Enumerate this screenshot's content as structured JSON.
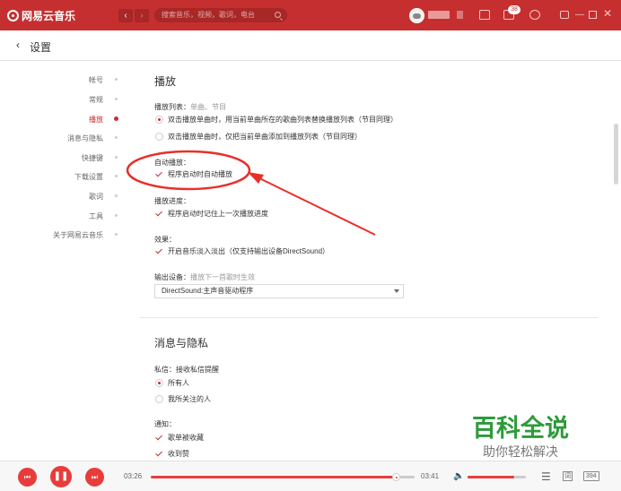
{
  "app": {
    "name": "网易云音乐",
    "search_placeholder": "搜索音乐，视频，歌词，电台",
    "notification_count": "38"
  },
  "page": {
    "title": "设置",
    "back_glyph": "‹"
  },
  "nav": {
    "items": [
      {
        "label": "帐号",
        "active": false
      },
      {
        "label": "常规",
        "active": false
      },
      {
        "label": "播放",
        "active": true
      },
      {
        "label": "消息与隐私",
        "active": false
      },
      {
        "label": "快捷键",
        "active": false
      },
      {
        "label": "下载设置",
        "active": false
      },
      {
        "label": "歌词",
        "active": false
      },
      {
        "label": "工具",
        "active": false
      },
      {
        "label": "关于网易云音乐",
        "active": false
      }
    ]
  },
  "play": {
    "title": "播放",
    "playlist_label": "播放列表：",
    "playlist_sub": "单曲、节目",
    "playlist_options": [
      {
        "label": "双击播放单曲时，用当前单曲所在的歌曲列表替换播放列表（节目同理）",
        "checked": true
      },
      {
        "label": "双击播放单曲时，仅把当前单曲添加到播放列表（节目同理）",
        "checked": false
      }
    ],
    "autoplay_label": "自动播放：",
    "autoplay_option": "程序启动时自动播放",
    "progress_label": "播放进度：",
    "progress_option": "程序启动时记住上一次播放进度",
    "effect_label": "效果：",
    "effect_option": "开启音乐淡入淡出（仅支持输出设备DirectSound）",
    "output_label": "输出设备：",
    "output_sub": "播放下一首歌时生效",
    "output_value": "DirectSound:主声音驱动程序"
  },
  "privacy": {
    "title": "消息与隐私",
    "dm_label": "私信：",
    "dm_sub": "接收私信提醒",
    "dm_options": [
      {
        "label": "所有人",
        "checked": true
      },
      {
        "label": "我所关注的人",
        "checked": false
      }
    ],
    "notify_label": "通知：",
    "notify_options": [
      {
        "label": "歌单被收藏",
        "checked": true
      },
      {
        "label": "收到赞",
        "checked": true
      }
    ]
  },
  "player": {
    "current_time": "03:26",
    "duration": "03:41",
    "progress_fraction": 0.93,
    "volume_fraction": 0.8,
    "lyric_label": "词",
    "playlist_count": "394"
  },
  "watermark": {
    "line1": "百科全说",
    "line2": "助你轻松解决"
  },
  "colors": {
    "accent": "#c62f2f",
    "annotation": "#e8302a",
    "watermark": "#2b9b3a"
  },
  "icons": [
    "logo-icon",
    "back-arrow-icon",
    "forward-arrow-icon",
    "search-icon",
    "avatar-icon",
    "skin-icon",
    "mail-icon",
    "gear-icon",
    "mini-mode-icon",
    "minimize-icon",
    "maximize-icon",
    "close-icon",
    "prev-icon",
    "play-pause-icon",
    "next-icon",
    "volume-icon",
    "playlist-icon"
  ]
}
